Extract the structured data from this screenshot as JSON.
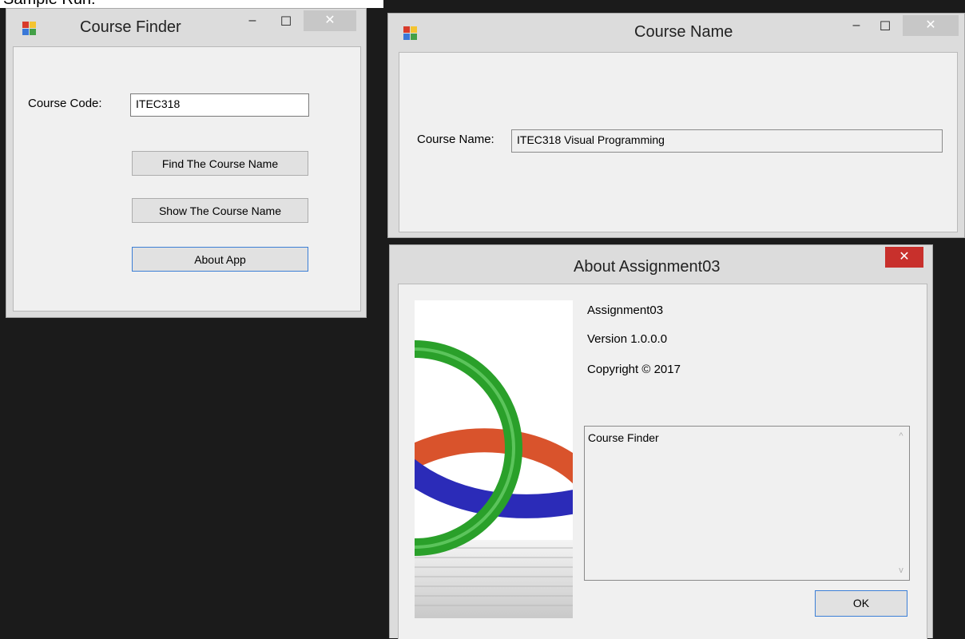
{
  "caption": "Sample Run:",
  "course_finder": {
    "title": "Course Finder",
    "controls": {
      "minimize": "–",
      "maximize": "☐",
      "close": "✕"
    },
    "course_code_label": "Course Code:",
    "course_code_value": "ITEC318",
    "find_button": "Find The Course Name",
    "show_button": "Show The Course Name",
    "about_button": "About App"
  },
  "course_name": {
    "title": "Course Name",
    "controls": {
      "minimize": "–",
      "maximize": "☐",
      "close": "✕"
    },
    "course_name_label": "Course Name:",
    "course_name_value": "ITEC318 Visual Programming"
  },
  "about": {
    "title": "About Assignment03",
    "close": "✕",
    "product_name": "Assignment03",
    "version": "Version 1.0.0.0",
    "copyright": "Copyright © 2017",
    "description": "Course Finder",
    "scroll_up": "^",
    "scroll_down": "v",
    "ok_button": "OK",
    "image_colors": {
      "green": "#2aa02a",
      "blue": "#2b2bb8",
      "orange": "#d9532c"
    }
  },
  "icon_colors": {
    "red": "#d83b2b",
    "yellow": "#f4c430",
    "blue": "#3a78d8",
    "green": "#43a047"
  }
}
